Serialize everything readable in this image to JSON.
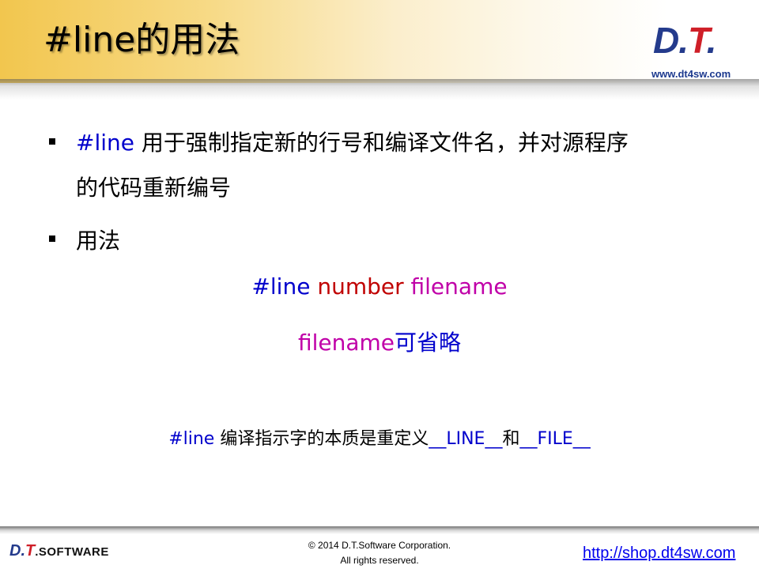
{
  "slide": {
    "title": "#line的用法",
    "logo": {
      "d": "D",
      "dot1": ".",
      "t": "T",
      "dot2": "."
    },
    "site_url": "www.dt4sw.com"
  },
  "bullets": [
    {
      "keyword": "#line",
      "text_line1": " 用于强制指定新的行号和编译文件名，并对源程序",
      "text_line2": "的代码重新编号"
    },
    {
      "text": "用法"
    }
  ],
  "usage": {
    "directive": "#line",
    "arg_number": "number",
    "arg_filename": "filename",
    "optional_name": "filename",
    "optional_text": "可省略"
  },
  "note": {
    "directive": "#line",
    "text": " 编译指示字的本质是重定义",
    "macro1": "__LINE__",
    "joiner": "和",
    "macro2": "__FILE__"
  },
  "footer": {
    "logo_dt": "D.",
    "logo_t": "T",
    "logo_software": ".SOFTWARE",
    "copyright_line1": "© 2014 D.T.Software Corporation.",
    "copyright_line2": "All rights reserved.",
    "shop_link": "http://shop.dt4sw.com"
  },
  "colors": {
    "keyword_blue": "#0000cc",
    "number_red": "#c00000",
    "filename_magenta": "#c000a8",
    "logo_blue": "#243b8c",
    "logo_red": "#cf1f28",
    "header_gold": "#f2c64e"
  }
}
